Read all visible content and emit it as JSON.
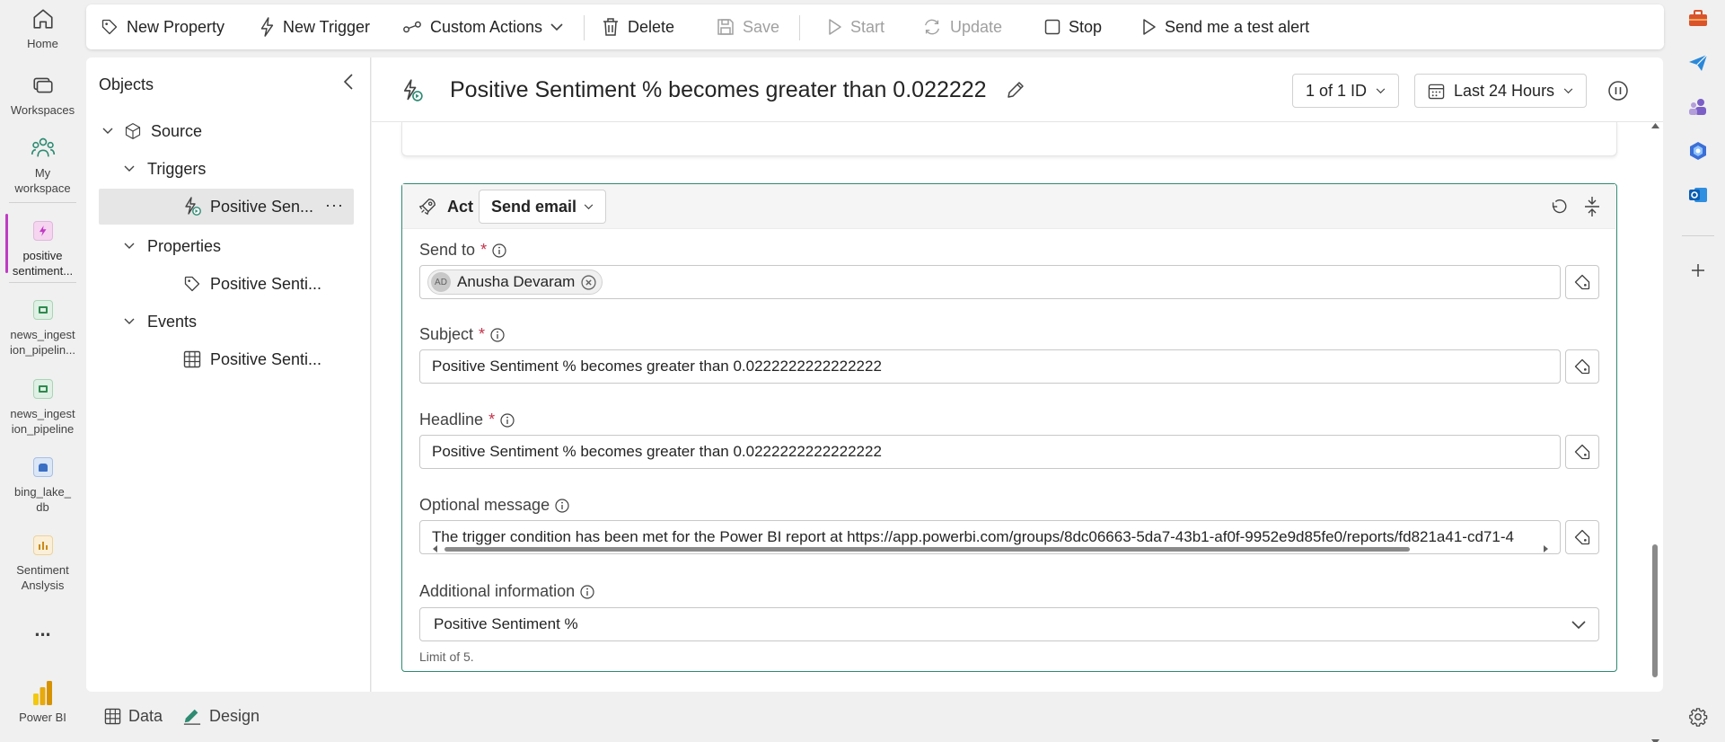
{
  "left_rail": {
    "home": "Home",
    "workspaces": "Workspaces",
    "my_workspace": "My workspace",
    "active_item": "positive sentiment...",
    "item1": "news_ingestion_pipelin...",
    "item2": "news_ingestion_pipeline",
    "item3": "bing_lake_db",
    "item4": "Sentiment Anslysis",
    "more": "...",
    "brand": "Power BI"
  },
  "toolbar": {
    "new_property": "New Property",
    "new_trigger": "New Trigger",
    "custom_actions": "Custom Actions",
    "delete": "Delete",
    "save": "Save",
    "start": "Start",
    "update": "Update",
    "stop": "Stop",
    "send_test_alert": "Send me a test alert"
  },
  "objects": {
    "title": "Objects",
    "source": "Source",
    "triggers": "Triggers",
    "trigger_item": "Positive Sen...",
    "properties": "Properties",
    "property_item": "Positive Senti...",
    "events": "Events",
    "event_item": "Positive Senti..."
  },
  "header": {
    "title": "Positive Sentiment % becomes greater than 0.022222",
    "id_selector": "1 of 1 ID",
    "time_range": "Last 24 Hours"
  },
  "act": {
    "label": "Act",
    "action_type": "Send email",
    "send_to_label": "Send to",
    "recipient_initials": "AD",
    "recipient_name": "Anusha Devaram",
    "subject_label": "Subject",
    "subject_value": "Positive Sentiment % becomes greater than 0.0222222222222222",
    "headline_label": "Headline",
    "headline_value": "Positive Sentiment % becomes greater than 0.0222222222222222",
    "optional_message_label": "Optional message",
    "optional_message_value": "The trigger condition has been met for the Power BI report at https://app.powerbi.com/groups/8dc06663-5da7-43b1-af0f-9952e9d85fe0/reports/fd821a41-cd71-4",
    "additional_info_label": "Additional information",
    "additional_info_value": "Positive Sentiment %",
    "limit_note": "Limit of 5.",
    "required_mark": "*"
  },
  "bottom_tabs": {
    "data": "Data",
    "design": "Design"
  },
  "colors": {
    "accent_green": "#2e8b72",
    "active_pink": "#c03bc4",
    "required_red": "#c4314b"
  }
}
